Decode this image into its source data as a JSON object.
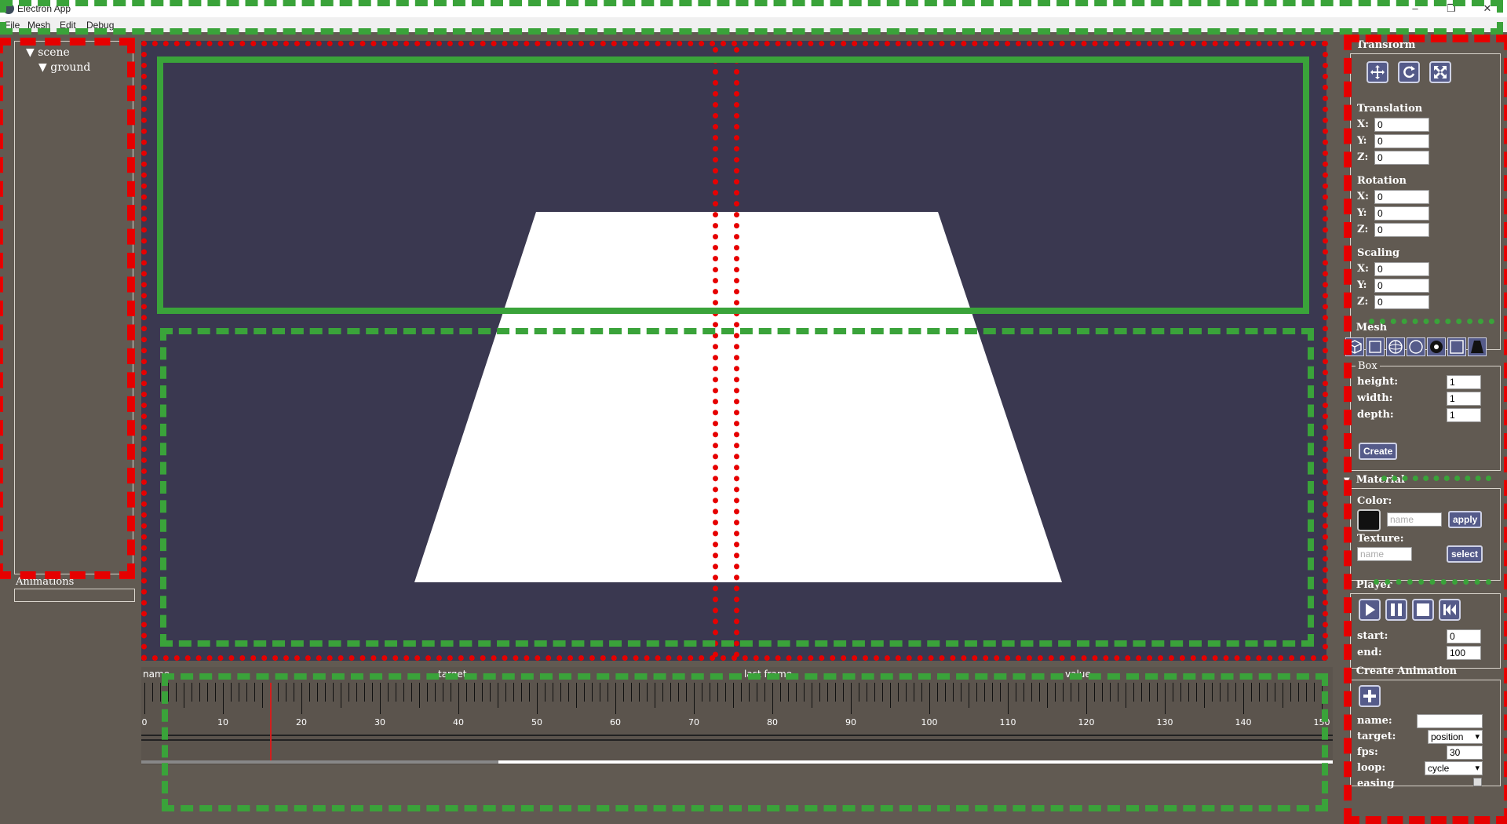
{
  "window": {
    "title": "Electron App",
    "minimize_glyph": "–",
    "maximize_glyph": "❐",
    "close_glyph": "✕"
  },
  "menu": [
    "File",
    "Mesh",
    "Edit",
    "Debug"
  ],
  "scene_tree": {
    "root": "scene",
    "child": "ground",
    "animations_label": "Animations"
  },
  "timeline": {
    "columns": [
      "name",
      "target",
      "last frame",
      "value"
    ],
    "ticks": [
      "0",
      "10",
      "20",
      "30",
      "40",
      "50",
      "60",
      "70",
      "80",
      "90",
      "100",
      "110",
      "120",
      "130",
      "140",
      "150"
    ],
    "playhead_frame": 16,
    "scroll_fraction": 0.3
  },
  "transform": {
    "title": "Transform",
    "icons": [
      "move-icon",
      "rotate-icon",
      "scale-icon"
    ],
    "translation": {
      "label": "Translation",
      "x": "0",
      "y": "0",
      "z": "0"
    },
    "rotation": {
      "label": "Rotation",
      "x": "0",
      "y": "0",
      "z": "0"
    },
    "scaling": {
      "label": "Scaling",
      "x": "0",
      "y": "0",
      "z": "0"
    },
    "x_label": "X:",
    "y_label": "Y:",
    "z_label": "Z:"
  },
  "mesh": {
    "title": "Mesh",
    "shape_icons": [
      "box-icon",
      "plane-icon",
      "sphere-icon",
      "circle-icon",
      "torus-icon",
      "ground-icon",
      "cylinder-icon"
    ],
    "box": {
      "legend": "Box",
      "height_label": "height:",
      "height": "1",
      "width_label": "width:",
      "width": "1",
      "depth_label": "depth:",
      "depth": "1",
      "create_label": "Create"
    }
  },
  "material": {
    "title": "Material",
    "color_label": "Color:",
    "color_value": "#111111",
    "name_placeholder": "name",
    "apply_label": "apply",
    "texture_label": "Texture:",
    "texture_placeholder": "name",
    "select_label": "select"
  },
  "player": {
    "title": "Player",
    "icons": [
      "play-icon",
      "pause-icon",
      "stop-icon",
      "rewind-icon"
    ],
    "start_label": "start:",
    "start": "0",
    "end_label": "end:",
    "end": "100"
  },
  "create_animation": {
    "title": "Create Animation",
    "name_label": "name:",
    "name_value": "",
    "target_label": "target:",
    "target_value": "position",
    "fps_label": "fps:",
    "fps_value": "30",
    "loop_label": "loop:",
    "loop_value": "cycle",
    "easing_label": "easing"
  },
  "colors": {
    "background": "#615a52",
    "viewport": "#3a3850",
    "button": "#555b8a",
    "annotation_red": "#e60000",
    "annotation_green": "#3aa33a"
  }
}
